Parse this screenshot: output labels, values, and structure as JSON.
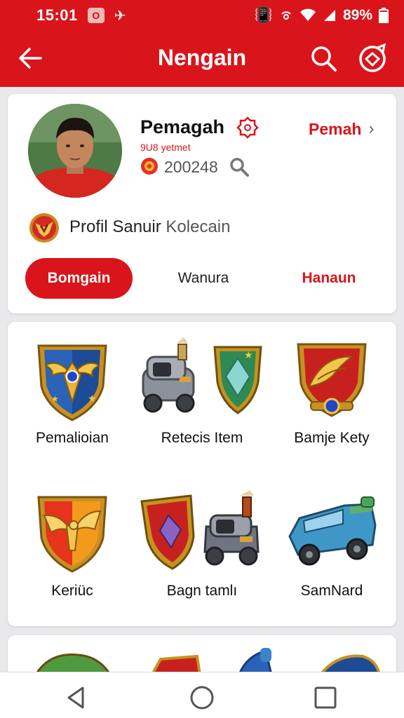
{
  "status_bar": {
    "time": "15:01",
    "notif_char": "O",
    "battery": "89%"
  },
  "app_bar": {
    "title": "Nengain"
  },
  "profile": {
    "name": "Pemagah",
    "subtitle": "9U8 yetmet",
    "coins": "200248",
    "follow_label": "Pemah",
    "chevron": "›",
    "collection_label_main": "Profil Sanuir",
    "collection_label_muted": "Kolecain"
  },
  "tabs": [
    {
      "label": "Bomgain",
      "active": true
    },
    {
      "label": "Wanura",
      "active": false
    },
    {
      "label": "Hanaun",
      "active": false
    }
  ],
  "items": [
    {
      "label": "Pemalioian",
      "icon": "blue-winged-shield-icon"
    },
    {
      "label": "Retecis Item",
      "icon": "cannon-and-green-shield-icon"
    },
    {
      "label": "Bamje Kety",
      "icon": "red-winged-shield-icon"
    },
    {
      "label": "Keriüc",
      "icon": "phoenix-shield-icon"
    },
    {
      "label": "Bagn tamlı",
      "icon": "purple-shield-and-cannon-icon"
    },
    {
      "label": "SamNard",
      "icon": "blue-vehicle-icon"
    }
  ],
  "colors": {
    "primary": "#d9151b",
    "background": "#e9e9ec"
  }
}
